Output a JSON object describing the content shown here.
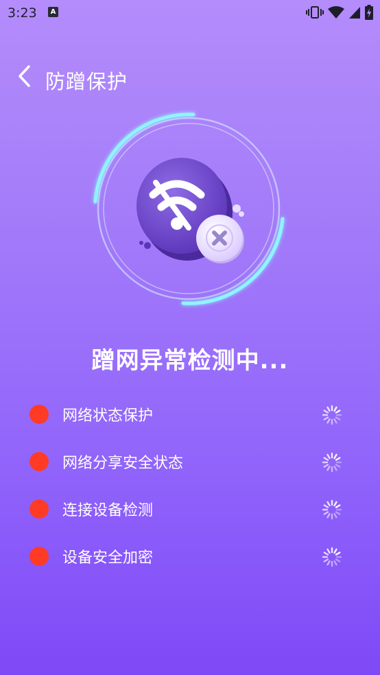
{
  "status_bar": {
    "time": "3:23",
    "notification_icon": "A",
    "icons": [
      "vibrate-icon",
      "wifi-icon",
      "cellular-signal-icon",
      "battery-charging-icon"
    ]
  },
  "header": {
    "back_icon": "chevron-left-icon",
    "title": "防蹭保护"
  },
  "hero": {
    "icon": "wifi-blocked-icon",
    "badge_icon": "close-icon"
  },
  "scan": {
    "title": "蹭网异常检测中..."
  },
  "checks": [
    {
      "label": "网络状态保护",
      "status": "loading"
    },
    {
      "label": "网络分享安全状态",
      "status": "loading"
    },
    {
      "label": "连接设备检测",
      "status": "loading"
    },
    {
      "label": "设备安全加密",
      "status": "loading"
    }
  ],
  "colors": {
    "background_top": "#b48cfb",
    "background_bottom": "#7f49f7",
    "status_dot": "#ff3b26",
    "ring_glow": "#7ff3ff"
  }
}
